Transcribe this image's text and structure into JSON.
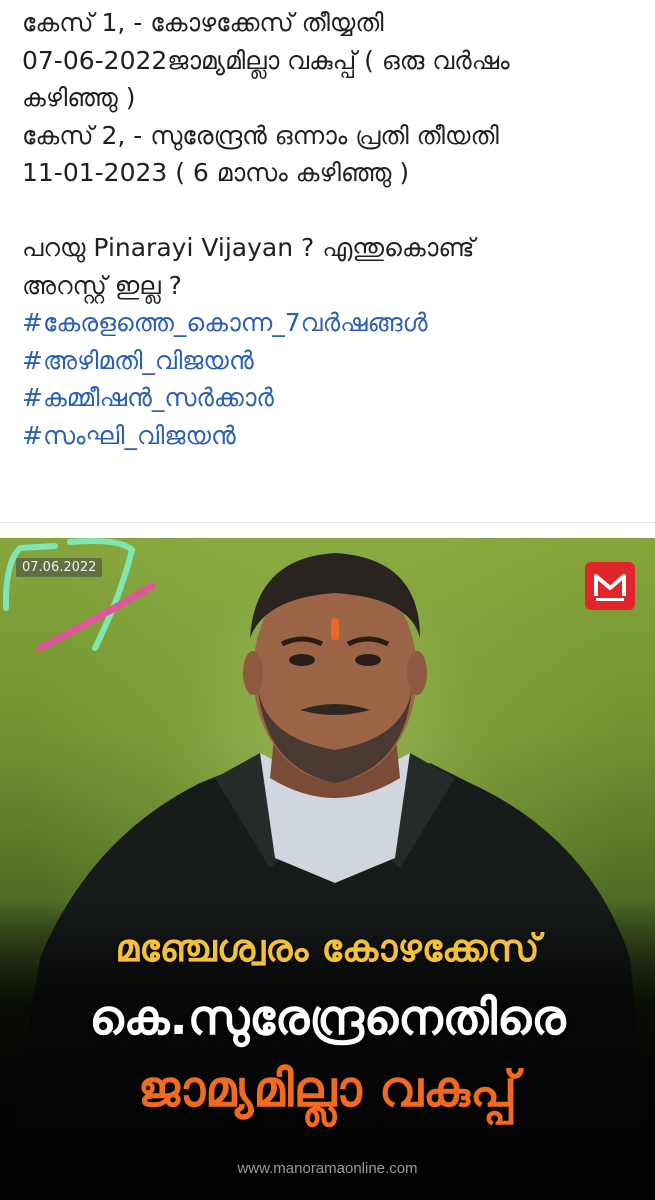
{
  "post": {
    "text_lines": [
      "കേസ് 1, - കോഴക്കേസ് തീയ്യതി",
      "07-06-2022ജാമ്യമില്ലാ വകുപ്പ് ( ഒരു വർഷം",
      "കഴിഞ്ഞു )",
      "കേസ് 2, - സുരേന്ദ്രൻ ഒന്നാം പ്രതി തീയതി",
      "11-01-2023 ( 6 മാസം കഴിഞ്ഞു )",
      "",
      "പറയു Pinarayi Vijayan ? എന്തുകൊണ്ട്",
      "അറസ്റ്റ് ഇല്ല ?"
    ],
    "hashtags": [
      "#കേരളത്തെ_കൊന്ന_7വർഷങ്ങൾ",
      "#അഴിമതി_വിജയൻ",
      "#കമ്മീഷൻ_സർക്കാർ",
      "#സംഘി_വിജയൻ"
    ]
  },
  "image": {
    "date_stamp": "07.06.2022",
    "brand_letter": "M",
    "headline_line1": "മഞ്ചേശ്വരം കോഴക്കേസ്",
    "headline_line2": "കെ.സുരേന്ദ്രനെതിരെ",
    "headline_line3": "ജാമ്യമില്ലാ വകുപ്പ്",
    "watermark": "www.manoramaonline.com"
  },
  "colors": {
    "hashtag": "#2b5fb4",
    "text": "#1f1f1f",
    "headline_yellow": "#f4c03a",
    "headline_orange": "#f26a1f",
    "brand_red": "#e0252b",
    "annotation_green": "#7ee6b0",
    "annotation_pink": "#e0569a"
  }
}
